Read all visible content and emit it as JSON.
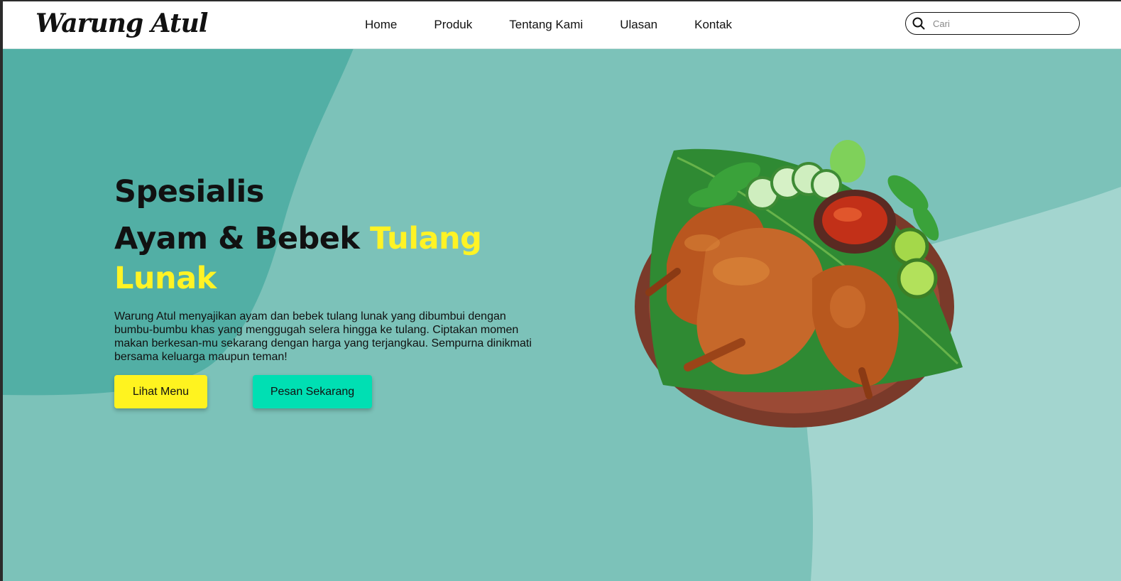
{
  "brand": {
    "logo_text": "Warung Atul"
  },
  "nav": {
    "items": [
      {
        "label": "Home"
      },
      {
        "label": "Produk"
      },
      {
        "label": "Tentang Kami"
      },
      {
        "label": "Ulasan"
      },
      {
        "label": "Kontak"
      }
    ]
  },
  "search": {
    "placeholder": "Cari",
    "value": "",
    "icon": "search-icon"
  },
  "hero": {
    "line1": "Spesialis",
    "line2_plain": "Ayam & Bebek ",
    "line2_highlight": "Tulang Lunak",
    "description": "Warung Atul menyajikan ayam dan bebek tulang lunak yang dibumbui dengan bumbu-bumbu khas yang menggugah selera hingga ke tulang. Ciptakan momen makan berkesan-mu sekarang dengan harga yang terjangkau. Sempurna dinikmati bersama keluarga maupun teman!",
    "image": "fried-chicken-platter"
  },
  "buttons": {
    "menu_label": "Lihat Menu",
    "order_label": "Pesan Sekarang"
  },
  "colors": {
    "background": "#7cc2b9",
    "blob_dark": "#52afa5",
    "blob_light": "#a3d5cf",
    "highlight": "#fff325",
    "btn_menu": "#fff31f",
    "btn_order": "#00dfb3"
  }
}
